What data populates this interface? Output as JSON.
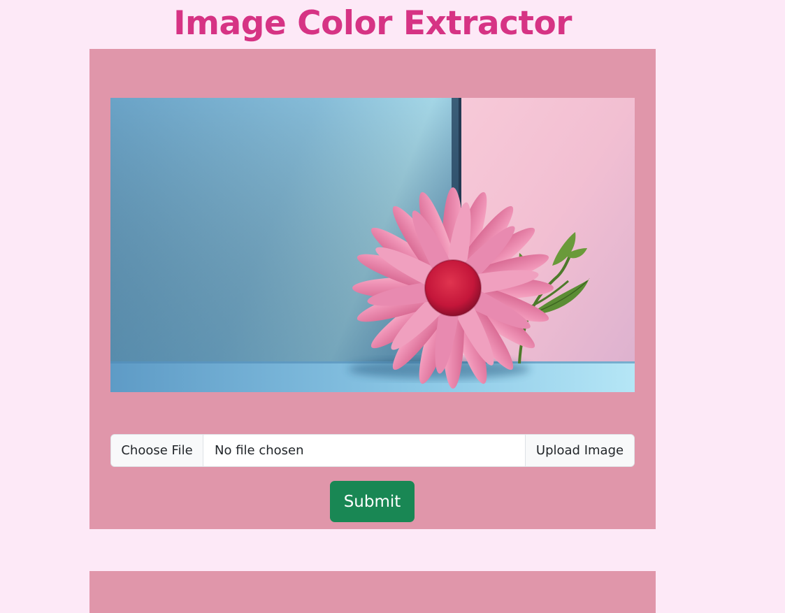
{
  "page": {
    "title": "Image Color Extractor"
  },
  "preview": {
    "alt": "Pink daisy flower against blue and pink wall",
    "icon": "image-preview"
  },
  "upload": {
    "choose_file_label": "Choose File",
    "file_status": "No file chosen",
    "upload_label": "Upload Image"
  },
  "actions": {
    "submit_label": "Submit"
  },
  "colors": {
    "page_background": "#fde9f7",
    "title": "#d63384",
    "card_background": "#e096aa",
    "submit_background": "#198754"
  }
}
